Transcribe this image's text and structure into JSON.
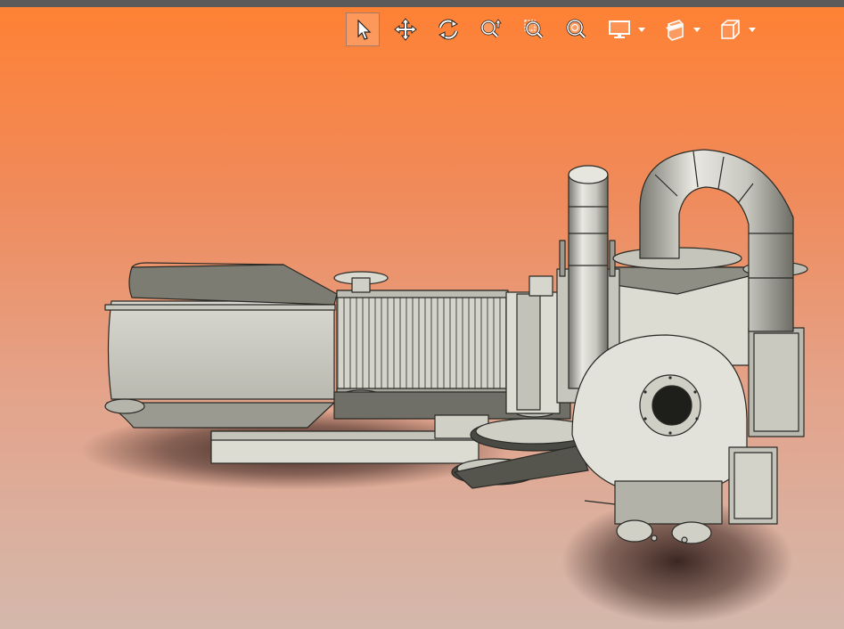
{
  "window": {
    "bar_color": "#5a5a5a"
  },
  "toolbar": {
    "tools": [
      {
        "name": "select-tool",
        "icon": "cursor-icon",
        "active": true
      },
      {
        "name": "pan-tool",
        "icon": "move-arrows-icon",
        "active": false
      },
      {
        "name": "rotate-tool",
        "icon": "rotate-icon",
        "active": false
      },
      {
        "name": "zoom-tool",
        "icon": "zoom-updown-icon",
        "active": false
      },
      {
        "name": "zoom-window-tool",
        "icon": "zoom-window-icon",
        "active": false
      },
      {
        "name": "zoom-fit-tool",
        "icon": "zoom-fit-icon",
        "active": false
      },
      {
        "name": "display-style-dropdown",
        "icon": "monitor-icon",
        "active": false
      },
      {
        "name": "section-view-dropdown",
        "icon": "section-icon",
        "active": false
      },
      {
        "name": "view-orientation-dropdown",
        "icon": "cube-icon",
        "active": false
      }
    ]
  },
  "viewport": {
    "background_top": "#ff8133",
    "background_bottom": "#d4b8ac",
    "model_color": "#cfcfc6",
    "model_shadow": "#3a2420"
  }
}
